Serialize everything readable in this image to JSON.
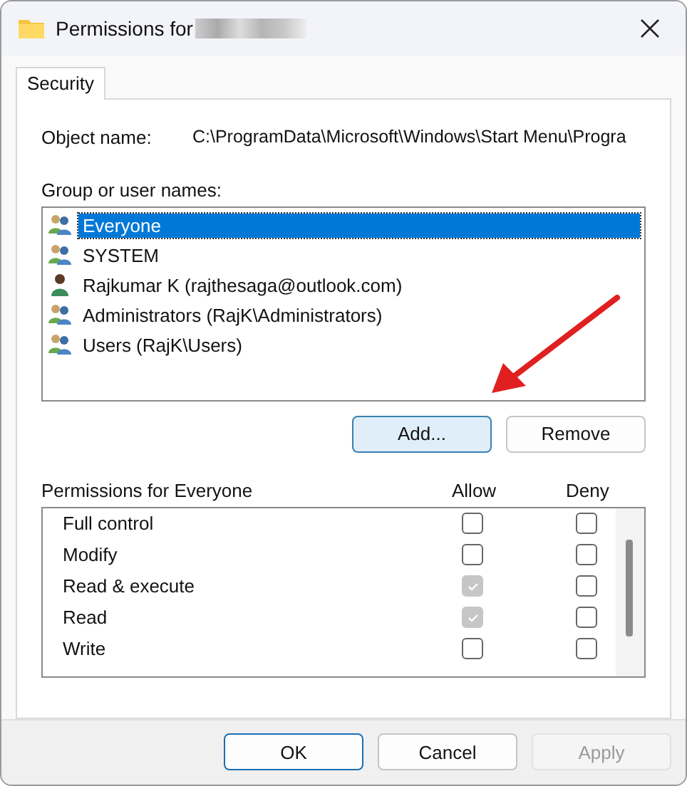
{
  "window": {
    "title": "Permissions for"
  },
  "tabs": [
    {
      "label": "Security",
      "selected": true
    }
  ],
  "object_name": {
    "label": "Object name:",
    "value": "C:\\ProgramData\\Microsoft\\Windows\\Start Menu\\Progra"
  },
  "users": {
    "label": "Group or user names:",
    "items": [
      {
        "name": "Everyone",
        "kind": "group",
        "selected": true
      },
      {
        "name": "SYSTEM",
        "kind": "group",
        "selected": false
      },
      {
        "name": "Rajkumar K (rajthesaga@outlook.com)",
        "kind": "user",
        "selected": false
      },
      {
        "name": "Administrators (RajK\\Administrators)",
        "kind": "group",
        "selected": false
      },
      {
        "name": "Users (RajK\\Users)",
        "kind": "group",
        "selected": false
      }
    ]
  },
  "user_buttons": [
    "Add...",
    "Remove"
  ],
  "permissions": {
    "label": "Permissions for Everyone",
    "allow_header": "Allow",
    "deny_header": "Deny",
    "rows": [
      {
        "name": "Full control",
        "allow": {
          "checked": false,
          "disabled": false
        },
        "deny": {
          "checked": false,
          "disabled": false
        }
      },
      {
        "name": "Modify",
        "allow": {
          "checked": false,
          "disabled": false
        },
        "deny": {
          "checked": false,
          "disabled": false
        }
      },
      {
        "name": "Read & execute",
        "allow": {
          "checked": true,
          "disabled": true
        },
        "deny": {
          "checked": false,
          "disabled": false
        }
      },
      {
        "name": "Read",
        "allow": {
          "checked": true,
          "disabled": true
        },
        "deny": {
          "checked": false,
          "disabled": false
        }
      },
      {
        "name": "Write",
        "allow": {
          "checked": false,
          "disabled": false
        },
        "deny": {
          "checked": false,
          "disabled": false
        }
      }
    ]
  },
  "buttons": [
    {
      "label": "OK",
      "disabled": false
    },
    {
      "label": "Cancel",
      "disabled": false
    },
    {
      "label": "Apply",
      "disabled": true
    }
  ]
}
